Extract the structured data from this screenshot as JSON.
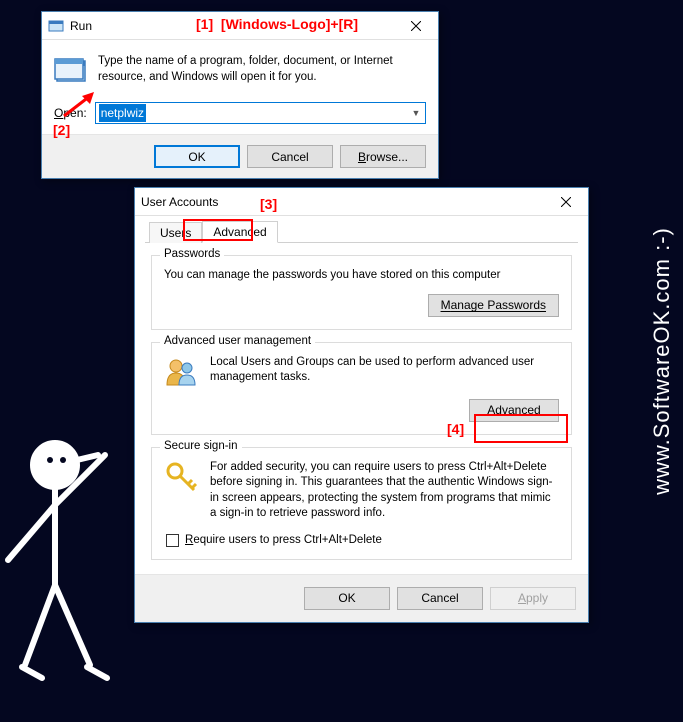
{
  "watermark": "www.SoftwareOK.com :-)",
  "annotations": {
    "a1": "[1]",
    "a1b": "[Windows-Logo]+[R]",
    "a2": "[2]",
    "a3": "[3]",
    "a4": "[4]"
  },
  "run": {
    "title": "Run",
    "description": "Type the name of a program, folder, document, or Internet resource, and Windows will open it for you.",
    "open_label": "Open:",
    "input_value": "netplwiz",
    "ok": "OK",
    "cancel": "Cancel",
    "browse": "Browse..."
  },
  "ua": {
    "title": "User Accounts",
    "tab_users": "Users",
    "tab_advanced": "Advanced",
    "passwords": {
      "title": "Passwords",
      "text": "You can manage the passwords you have stored on this computer",
      "button": "Manage Passwords"
    },
    "adv": {
      "title": "Advanced user management",
      "text": "Local Users and Groups can be used to perform advanced user management tasks.",
      "button": "Advanced"
    },
    "secure": {
      "title": "Secure sign-in",
      "text": "For added security, you can require users to press Ctrl+Alt+Delete before signing in. This guarantees that the authentic Windows sign-in screen appears, protecting the system from programs that mimic a sign-in to retrieve password info.",
      "checkbox": "Require users to press Ctrl+Alt+Delete"
    },
    "ok": "OK",
    "cancel": "Cancel",
    "apply": "Apply"
  }
}
